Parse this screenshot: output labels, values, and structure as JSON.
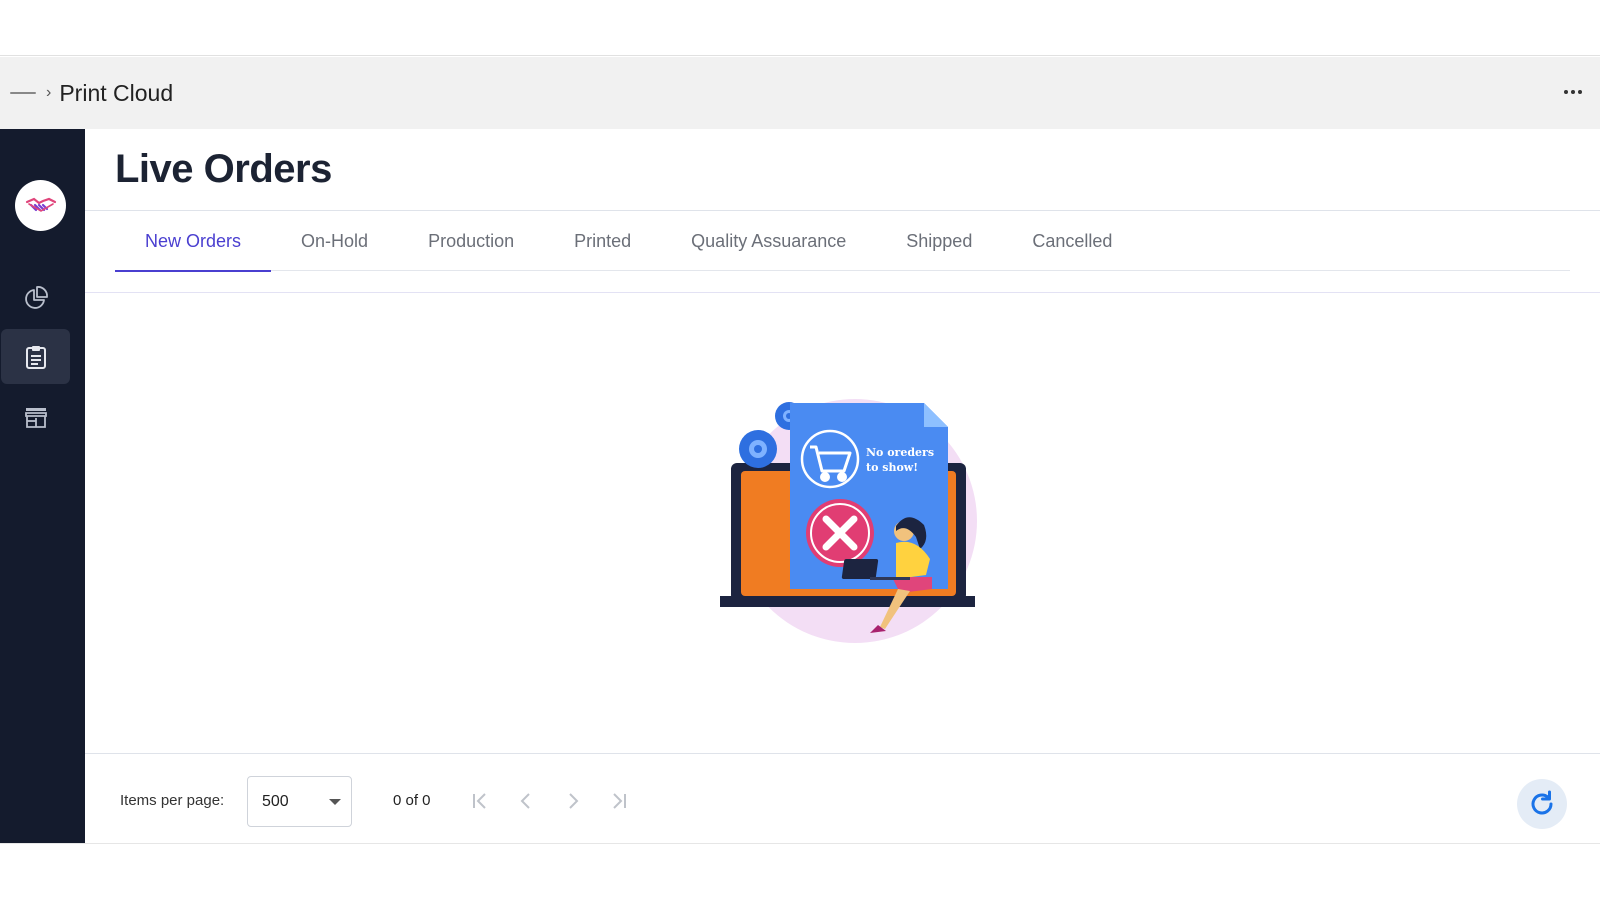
{
  "breadcrumb": {
    "separator": "›",
    "title": "Print Cloud"
  },
  "header": {
    "more_icon": "more-horizontal-icon"
  },
  "sidebar": {
    "brand_icon": "handshake-icon",
    "items": [
      {
        "icon": "pie-chart-icon",
        "active": false
      },
      {
        "icon": "clipboard-icon",
        "active": true
      },
      {
        "icon": "store-icon",
        "active": false
      }
    ]
  },
  "page": {
    "title": "Live Orders"
  },
  "tabs": [
    {
      "label": "New Orders",
      "active": true
    },
    {
      "label": "On-Hold",
      "active": false
    },
    {
      "label": "Production",
      "active": false
    },
    {
      "label": "Printed",
      "active": false
    },
    {
      "label": "Quality Assuarance",
      "active": false
    },
    {
      "label": "Shipped",
      "active": false
    },
    {
      "label": "Cancelled",
      "active": false
    }
  ],
  "empty_state": {
    "line1": "No oreders",
    "line2": "to show!"
  },
  "pagination": {
    "items_per_page_label": "Items per page:",
    "items_per_page_value": "500",
    "range_label": "0 of 0"
  },
  "colors": {
    "accent": "#4a3fd0",
    "sidebar": "#141b2d",
    "refresh": "#1a73e8"
  }
}
